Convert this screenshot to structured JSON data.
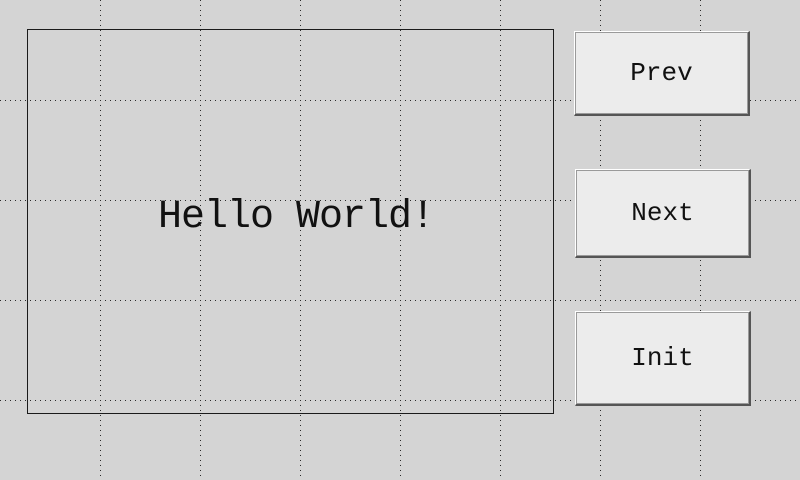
{
  "screen": {
    "background_color": "#d4d4d4",
    "grid_color": "#2a2a2a"
  },
  "display": {
    "text": "Hello World!"
  },
  "buttons": {
    "prev_label": "Prev",
    "next_label": "Next",
    "init_label": "Init"
  }
}
